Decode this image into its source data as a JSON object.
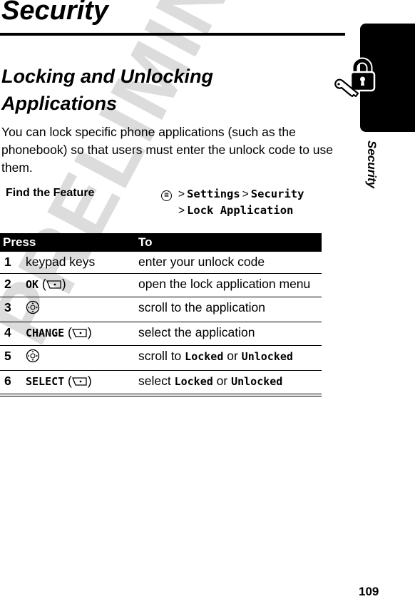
{
  "header": {
    "title": "Security"
  },
  "section": {
    "title": "Locking and Unlocking Applications",
    "intro": "You can lock specific phone applications (such as the phonebook) so that users must enter the unlock code to use them."
  },
  "find_feature": {
    "label": "Find the Feature",
    "menu_icon": "menu-key-icon",
    "path": [
      "Settings",
      "Security",
      "Lock Application"
    ],
    "separator": ">"
  },
  "table": {
    "headers": {
      "press": "Press",
      "to": "To"
    },
    "rows": [
      {
        "num": "1",
        "press": "keypad keys",
        "press_key": "",
        "icon": "",
        "to": "enter your unlock code"
      },
      {
        "num": "2",
        "press": "",
        "press_key": "OK",
        "icon": "soft-key-icon",
        "to": "open the lock application menu"
      },
      {
        "num": "3",
        "press": "",
        "press_key": "",
        "icon": "nav-key-icon",
        "to": "scroll to the application"
      },
      {
        "num": "4",
        "press": "",
        "press_key": "CHANGE",
        "icon": "soft-key-icon",
        "to": "select the application"
      },
      {
        "num": "5",
        "press": "",
        "press_key": "",
        "icon": "nav-key-icon",
        "to_prefix": "scroll to",
        "to_a": "Locked",
        "to_or": "or",
        "to_b": "Unlocked"
      },
      {
        "num": "6",
        "press": "",
        "press_key": "SELECT",
        "icon": "soft-key-icon",
        "to_prefix": "select",
        "to_a": "Locked",
        "to_or": "or",
        "to_b": "Unlocked"
      }
    ]
  },
  "side_tab": {
    "label": "Security",
    "icon": "lock-and-key-icon"
  },
  "watermark": "PRELIMINARY",
  "page_number": "109"
}
